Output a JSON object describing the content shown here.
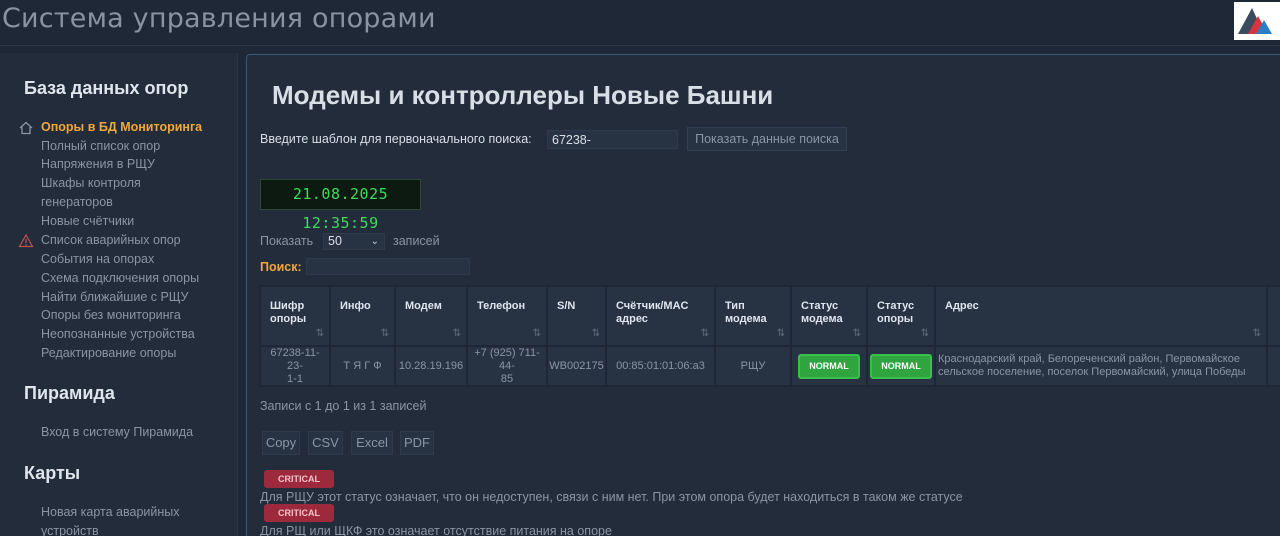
{
  "app_title": "Система управления опорами",
  "colors": {
    "accent": "#f0a83c",
    "normal": "#2fa43f",
    "critical": "#9c2a3c",
    "clock": "#3ddc5c"
  },
  "sidebar": {
    "section1_title": "База данных опор",
    "items": [
      {
        "label": "Опоры в БД Мониторинга",
        "icon": "home-icon",
        "active": true
      },
      {
        "label": "Полный список опор"
      },
      {
        "label": "Напряжения в РЩУ"
      },
      {
        "label": "Шкафы контроля"
      },
      {
        "label": "генераторов"
      },
      {
        "label": "Новые счётчики"
      },
      {
        "label": "Список аварийных опор",
        "icon": "warning-icon"
      },
      {
        "label": "События на опорах"
      },
      {
        "label": "Схема подключения опоры"
      },
      {
        "label": "Найти ближайшие с РЩУ"
      },
      {
        "label": "Опоры без мониторинга"
      },
      {
        "label": "Неопознанные устройства"
      },
      {
        "label": "Редактирование опоры"
      }
    ],
    "section2_title": "Пирамида",
    "section2_items": [
      {
        "label": "Вход в систему Пирамида"
      }
    ],
    "section3_title": "Карты",
    "section3_items": [
      {
        "label": "Новая карта аварийных"
      },
      {
        "label": "устройств"
      }
    ]
  },
  "main": {
    "title": "Модемы и контроллеры Новые Башни",
    "search_label": "Введите шаблон для первоначального поиска:",
    "search_value": "67238-",
    "search_button": "Показать данные поиска",
    "clock": "21.08.2025 12:35:59",
    "show_label": "Показать",
    "show_value": "50",
    "show_suffix": "записей",
    "filter_label": "Поиск:",
    "table": {
      "columns": [
        [
          "Шифр",
          "опоры"
        ],
        [
          "Инфо",
          ""
        ],
        [
          "Модем",
          ""
        ],
        [
          "Телефон",
          ""
        ],
        [
          "S/N",
          ""
        ],
        [
          "Счётчик/MAC",
          "адрес"
        ],
        [
          "Тип",
          "модема"
        ],
        [
          "Статус",
          "модема"
        ],
        [
          "Статус",
          "опоры"
        ],
        [
          "Адрес",
          ""
        ]
      ],
      "row": {
        "code": [
          "67238-11-23-",
          "1-1"
        ],
        "info": "Т Я Г Ф",
        "modem": "10.28.19.196",
        "phone": [
          "+7 (925) 711-44-",
          "85"
        ],
        "sn": "WB002175",
        "mac": "00:85:01:01:06:a3",
        "modem_type": "РЩУ",
        "modem_status": "NORMAL",
        "pole_status": "NORMAL",
        "address": [
          "Краснодарский край, Белореченский район, Первомайское",
          "сельское поселение, поселок Первомайский, улица Победы"
        ]
      }
    },
    "info": "Записи с 1 до 1 из 1 записей",
    "export_buttons": [
      "Copy",
      "CSV",
      "Excel",
      "PDF"
    ],
    "legend": [
      {
        "badge": "CRITICAL",
        "text": "Для РЩУ этот статус означает, что он недоступен, связи с ним нет. При этом опора будет находиться в таком же статусе"
      },
      {
        "badge": "CRITICAL",
        "text": "Для РЩ или ЩКФ это означает отсутствие питания на опоре"
      }
    ]
  }
}
